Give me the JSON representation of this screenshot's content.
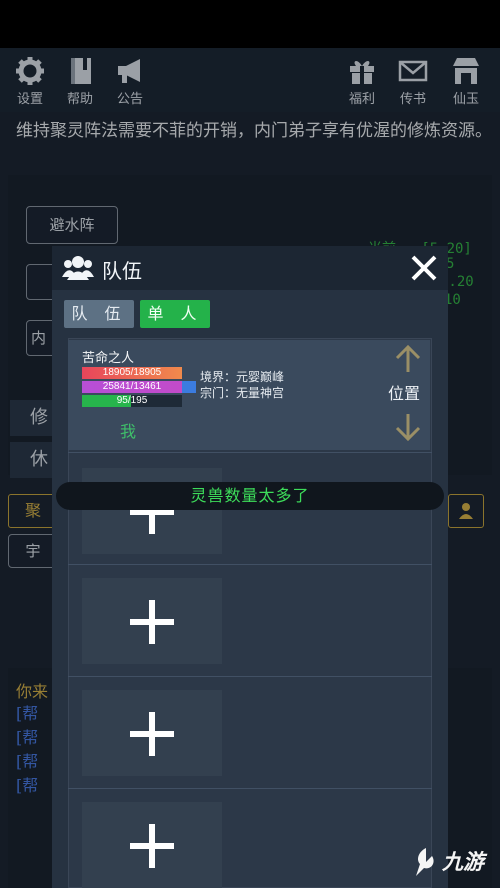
{
  "toolbar": {
    "left": [
      {
        "label": "设置",
        "icon": "gear-icon"
      },
      {
        "label": "帮助",
        "icon": "book-icon"
      },
      {
        "label": "公告",
        "icon": "megaphone-icon"
      }
    ],
    "right": [
      {
        "label": "福利",
        "icon": "gift-icon"
      },
      {
        "label": "传书",
        "icon": "mail-icon"
      },
      {
        "label": "仙玉",
        "icon": "shop-icon"
      }
    ]
  },
  "description": "维持聚灵阵法需要不菲的开销，内门弟子享有优渥的修炼资源。",
  "background": {
    "btn_water": "避水阵",
    "btn_ne": "内",
    "btn_xiu": "修",
    "btn_xiu2": "休",
    "btn_ju": "聚",
    "btn_yu": "宇",
    "green_lines": [
      "当前 · [5.20]",
      "5",
      "4.20",
      "10"
    ],
    "log_first": "你来",
    "log_lines": [
      "[帮",
      "[帮",
      "[帮",
      "[帮"
    ]
  },
  "dialog": {
    "title": "队伍",
    "tab_team": "队 伍",
    "tab_solo": "单 人",
    "member": {
      "name": "苦命之人",
      "hp": "18905/18905",
      "mp": "25841/13461",
      "xp": "95/195",
      "xp_fraction": 0.49,
      "realm": "境界：元婴巅峰",
      "sect": "宗门：无量神宫",
      "tag": "我",
      "position_label": "位置"
    },
    "empty_slot_count": 4
  },
  "toast": "灵兽数量太多了",
  "watermark": "九游",
  "colors": {
    "accent_green": "#24b24a",
    "toast_text": "#3ddc5a",
    "panel_bg": "#263241"
  }
}
